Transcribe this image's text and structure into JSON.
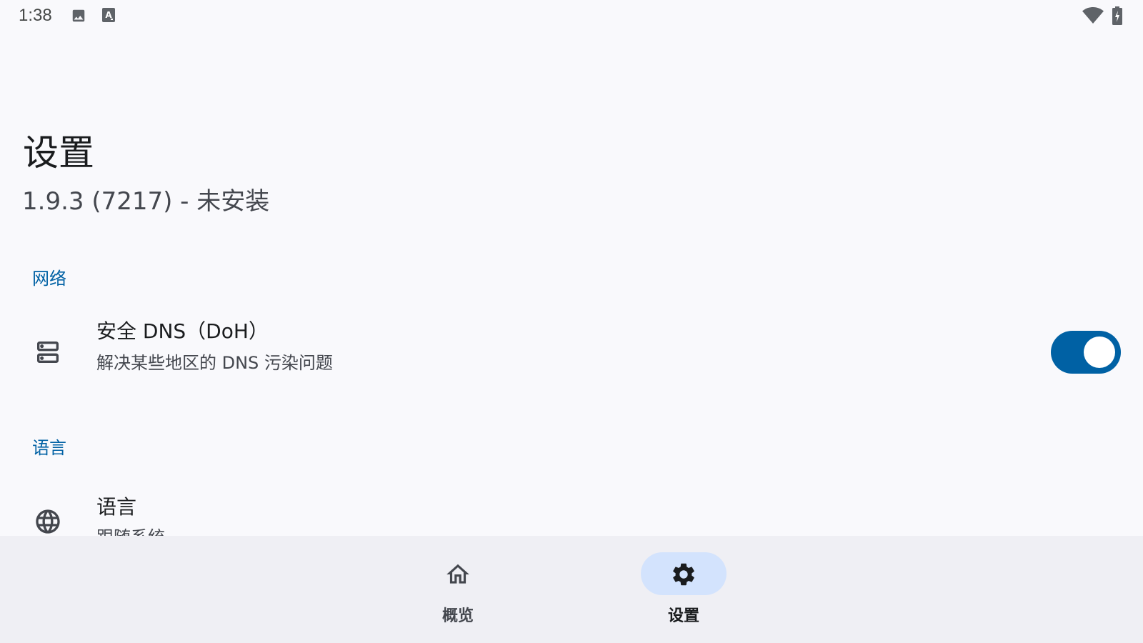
{
  "status_bar": {
    "time": "1:38",
    "icons": [
      "image-icon",
      "a-icon",
      "wifi-icon",
      "battery-charging-icon"
    ]
  },
  "header": {
    "title": "设置",
    "subtitle": "1.9.3 (7217) - 未安装"
  },
  "sections": {
    "network": {
      "header": "网络",
      "items": [
        {
          "icon": "dns-server-icon",
          "title": "安全 DNS（DoH）",
          "summary": "解决某些地区的 DNS 污染问题",
          "toggle_on": true
        }
      ]
    },
    "language": {
      "header": "语言",
      "items": [
        {
          "icon": "globe-icon",
          "title": "语言",
          "summary": "跟随系统"
        }
      ]
    }
  },
  "bottom_nav": {
    "items": [
      {
        "label": "概览",
        "icon": "home-icon",
        "selected": false
      },
      {
        "label": "设置",
        "icon": "gear-icon",
        "selected": true
      }
    ]
  },
  "colors": {
    "accent": "#0061a4",
    "background": "#f9f9fc",
    "nav_background": "#efeff4",
    "nav_selected_pill": "#d3e3fd"
  }
}
